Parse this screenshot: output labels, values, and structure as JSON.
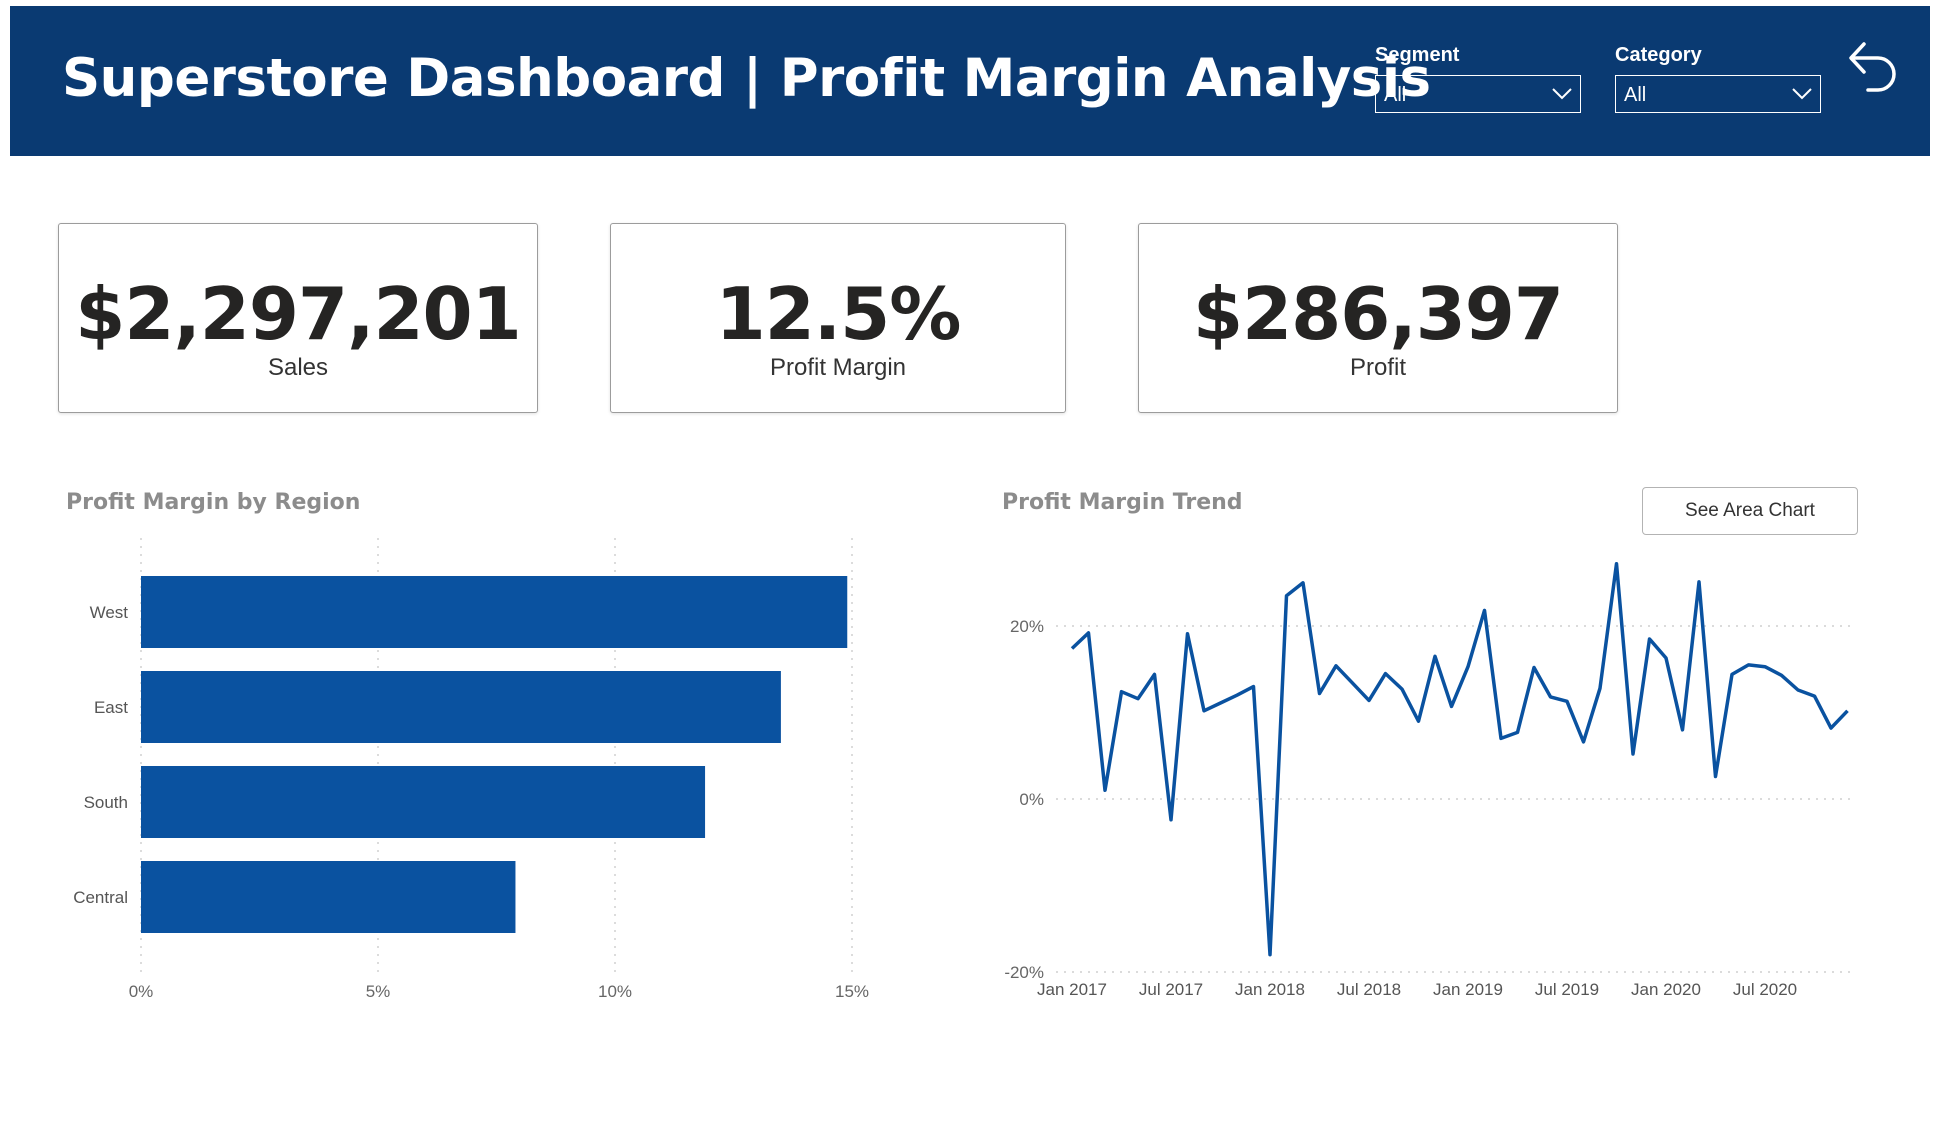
{
  "header": {
    "title": "Superstore Dashboard | Profit Margin Analysis",
    "filters": [
      {
        "label": "Segment",
        "value": "All"
      },
      {
        "label": "Category",
        "value": "All"
      }
    ],
    "back_icon": "back-arrow-icon"
  },
  "kpis": [
    {
      "value": "$2,297,201",
      "label": "Sales"
    },
    {
      "value": "12.5%",
      "label": "Profit Margin"
    },
    {
      "value": "$286,397",
      "label": "Profit"
    }
  ],
  "region_chart": {
    "title": "Profit Margin by Region"
  },
  "trend_chart": {
    "title": "Profit Margin Trend",
    "button_label": "See Area Chart"
  },
  "colors": {
    "header": "#0a3a72",
    "bar": "#0a52a0",
    "line": "#0a52a0"
  },
  "chart_data": [
    {
      "type": "bar",
      "orientation": "horizontal",
      "title": "Profit Margin by Region",
      "categories": [
        "West",
        "East",
        "South",
        "Central"
      ],
      "values": [
        14.9,
        13.5,
        11.9,
        7.9
      ],
      "xlim": [
        0,
        15
      ],
      "ticks": [
        "0%",
        "5%",
        "10%",
        "15%"
      ],
      "tick_values": [
        0,
        5,
        10,
        15
      ],
      "grid": true
    },
    {
      "type": "line",
      "title": "Profit Margin Trend",
      "x": [
        "2017-01",
        "2017-02",
        "2017-03",
        "2017-04",
        "2017-05",
        "2017-06",
        "2017-07",
        "2017-08",
        "2017-09",
        "2017-10",
        "2017-11",
        "2017-12",
        "2018-01",
        "2018-02",
        "2018-03",
        "2018-04",
        "2018-05",
        "2018-06",
        "2018-07",
        "2018-08",
        "2018-09",
        "2018-10",
        "2018-11",
        "2018-12",
        "2019-01",
        "2019-02",
        "2019-03",
        "2019-04",
        "2019-05",
        "2019-06",
        "2019-07",
        "2019-08",
        "2019-09",
        "2019-10",
        "2019-11",
        "2019-12",
        "2020-01",
        "2020-02",
        "2020-03",
        "2020-04",
        "2020-05",
        "2020-06",
        "2020-07",
        "2020-08",
        "2020-09",
        "2020-10",
        "2020-11",
        "2020-12"
      ],
      "values": [
        17.4,
        19.2,
        1.0,
        12.4,
        11.6,
        14.4,
        -2.4,
        19.1,
        10.2,
        11.1,
        12.0,
        13.0,
        -18.0,
        23.5,
        25.0,
        12.2,
        15.4,
        13.4,
        11.4,
        14.5,
        12.7,
        9.0,
        16.5,
        10.7,
        15.3,
        21.8,
        7.0,
        7.7,
        15.2,
        11.8,
        11.3,
        6.6,
        12.8,
        27.2,
        5.2,
        18.5,
        16.3,
        8.0,
        25.1,
        2.6,
        14.4,
        15.5,
        15.3,
        14.3,
        12.6,
        11.9,
        8.2,
        10.2
      ],
      "ylim": [
        -20,
        20
      ],
      "y_ticks": [
        "20%",
        "0%",
        "-20%"
      ],
      "y_tick_values": [
        20,
        0,
        -20
      ],
      "x_ticks": [
        "Jan 2017",
        "Jul 2017",
        "Jan 2018",
        "Jul 2018",
        "Jan 2019",
        "Jul 2019",
        "Jan 2020",
        "Jul 2020"
      ],
      "x_tick_values": [
        "2017-01",
        "2017-07",
        "2018-01",
        "2018-07",
        "2019-01",
        "2019-07",
        "2020-01",
        "2020-07"
      ],
      "grid": true
    }
  ]
}
